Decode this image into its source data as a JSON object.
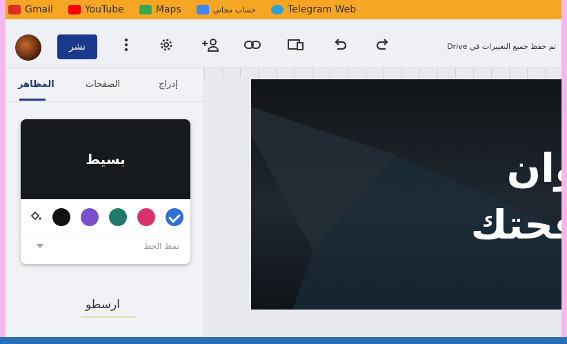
{
  "bookmarks": [
    {
      "label": "Gmail",
      "icon": "gmail-icon",
      "color": "#d93025"
    },
    {
      "label": "YouTube",
      "icon": "youtube-icon",
      "color": "#ff0000"
    },
    {
      "label": "Maps",
      "icon": "maps-icon",
      "color": "#34a853"
    },
    {
      "label": "حساب مجاني",
      "icon": "account-icon",
      "color": "#4285f4"
    },
    {
      "label": "Telegram Web",
      "icon": "telegram-icon",
      "color": "#2aa1da"
    }
  ],
  "toolbar": {
    "publish_label": "نشر",
    "saved_status": "تم حفظ جميع التغييرات في Drive"
  },
  "panel": {
    "tabs": [
      "المظاهر",
      "الصفحات",
      "إدراج"
    ],
    "active_tab": "المظاهر",
    "theme_name": "بسيط",
    "font_style_label": "نمط الخط",
    "next_theme": "ارسطو",
    "swatches": [
      "#2f6fd6",
      "#d6336c",
      "#1f7a6b",
      "#7b4fc9",
      "#111111"
    ],
    "selected_swatch": 0
  },
  "slide": {
    "title": "وان",
    "subtitle": "فحتك"
  }
}
